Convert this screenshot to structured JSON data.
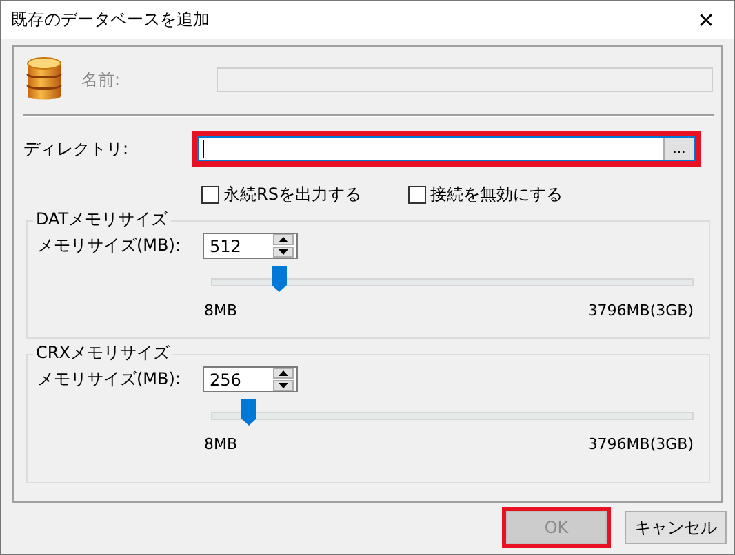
{
  "window": {
    "title": "既存のデータベースを追加",
    "close": "✕"
  },
  "name_field": {
    "label": "名前:",
    "disabled": true
  },
  "directory": {
    "label": "ディレクトリ:",
    "browse": "...",
    "highlighted": true
  },
  "options": [
    {
      "label": "永続RSを出力する",
      "checked": false
    },
    {
      "label": "接続を無効にする",
      "checked": false
    }
  ],
  "memory_groups": [
    {
      "title": "DATメモリサイズ",
      "label": "メモリサイズ(MB):",
      "value": "512",
      "level": 0.14,
      "min": "8MB",
      "max": "3796MB(3GB)"
    },
    {
      "title": "CRXメモリサイズ",
      "label": "メモリサイズ(MB):",
      "value": "256",
      "level": 0.077,
      "min": "8MB",
      "max": "3796MB(3GB)"
    }
  ],
  "buttons": [
    {
      "label": "OK",
      "disabled": true,
      "highlighted": true
    },
    {
      "label": "キャンセル",
      "disabled": false,
      "highlighted": false
    }
  ]
}
